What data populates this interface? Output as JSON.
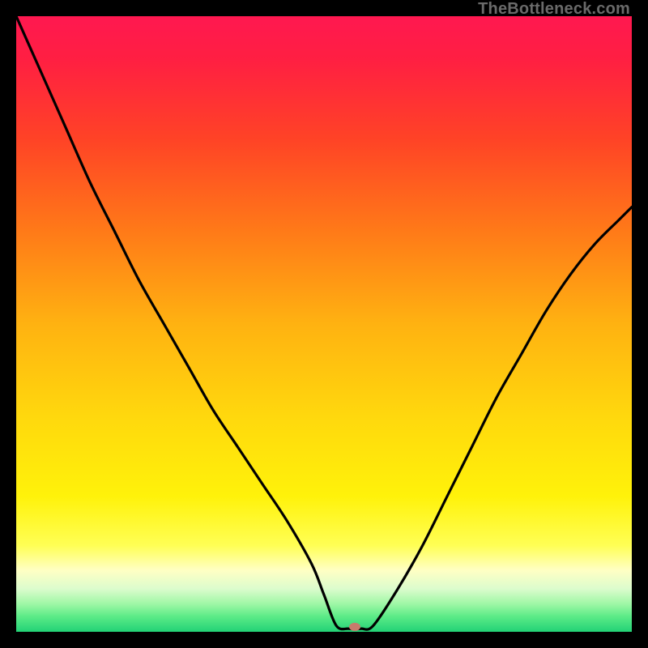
{
  "watermark": "TheBottleneck.com",
  "chart_data": {
    "type": "line",
    "title": "",
    "xlabel": "",
    "ylabel": "",
    "xlim": [
      0,
      100
    ],
    "ylim": [
      0,
      100
    ],
    "grid": false,
    "background_gradient": [
      {
        "stop": 0.0,
        "color": "#ff1850"
      },
      {
        "stop": 0.07,
        "color": "#ff1f42"
      },
      {
        "stop": 0.2,
        "color": "#ff4326"
      },
      {
        "stop": 0.35,
        "color": "#ff7a18"
      },
      {
        "stop": 0.5,
        "color": "#ffb211"
      },
      {
        "stop": 0.65,
        "color": "#ffd80d"
      },
      {
        "stop": 0.78,
        "color": "#fff20a"
      },
      {
        "stop": 0.86,
        "color": "#ffff55"
      },
      {
        "stop": 0.9,
        "color": "#ffffc4"
      },
      {
        "stop": 0.93,
        "color": "#dcfccd"
      },
      {
        "stop": 0.955,
        "color": "#9ef7a5"
      },
      {
        "stop": 0.975,
        "color": "#5ceb87"
      },
      {
        "stop": 1.0,
        "color": "#22d276"
      }
    ],
    "series": [
      {
        "name": "bottleneck-curve",
        "color": "#000000",
        "x": [
          0,
          4,
          8,
          12,
          16,
          20,
          24,
          28,
          32,
          36,
          40,
          44,
          48,
          50,
          52,
          54,
          56,
          58,
          62,
          66,
          70,
          74,
          78,
          82,
          86,
          90,
          94,
          98,
          100
        ],
        "y": [
          100,
          91,
          82,
          73,
          65,
          57,
          50,
          43,
          36,
          30,
          24,
          18,
          11,
          6,
          1,
          0.5,
          0.5,
          1,
          7,
          14,
          22,
          30,
          38,
          45,
          52,
          58,
          63,
          67,
          69
        ]
      }
    ],
    "marker": {
      "x": 55,
      "y": 0.8,
      "color": "#c77a6c",
      "rx": 7,
      "ry": 5
    }
  }
}
